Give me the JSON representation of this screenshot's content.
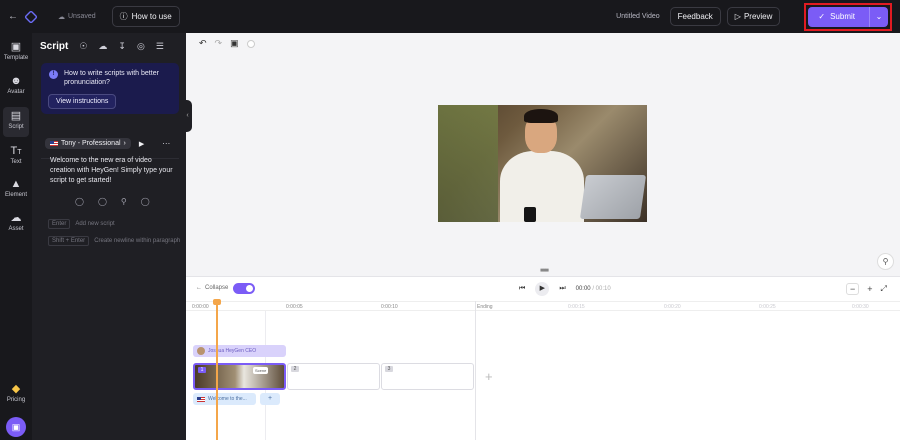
{
  "topbar": {
    "back_icon": "arrow-left-icon",
    "status_label": "Unsaved",
    "how_to_label": "How to use",
    "video_title": "Untitled Video",
    "feedback_label": "Feedback",
    "preview_label": "Preview",
    "submit_label": "Submit"
  },
  "nav": {
    "items": [
      {
        "label": "Template",
        "icon": "layout-icon"
      },
      {
        "label": "Avatar",
        "icon": "avatar-icon"
      },
      {
        "label": "Script",
        "icon": "script-icon"
      },
      {
        "label": "Text",
        "icon": "text-icon"
      },
      {
        "label": "Element",
        "icon": "shapes-icon"
      },
      {
        "label": "Asset",
        "icon": "cloud-upload-icon"
      }
    ],
    "active": "Script",
    "pricing_label": "Pricing"
  },
  "script_panel": {
    "title": "Script",
    "tip_text": "How to write scripts with better pronunciation?",
    "tip_button": "View instructions",
    "voice_name": "Tony - Professional",
    "script_text": "Welcome to the new era of video creation with HeyGen! Simply type your script to get started!",
    "hint_enter_key": "Enter",
    "hint_enter_text": "Add new script",
    "hint_shift_key": "Shift + Enter",
    "hint_shift_text": "Create newline within paragraph"
  },
  "timeline": {
    "collapse_label": "Collapse",
    "timecode_current": "00:00",
    "timecode_total": "/ 00:10",
    "ticks": [
      "0:00:00",
      "0:00:05",
      "0:00:10"
    ],
    "ending_label": "Ending",
    "faint_ticks": [
      "0:00:15",
      "0:00:20",
      "0:00:25",
      "0:00:30",
      "0:00:35"
    ],
    "avatar_track_label": "Joshua HeyGen CEO",
    "script_track_label": "Welcome to the...",
    "scene_numbers": [
      "1",
      "2",
      "3"
    ],
    "scene_chip": "Scene"
  },
  "colors": {
    "accent": "#7b5cf6",
    "highlight": "#e11b22",
    "playhead": "#f4a64a"
  }
}
